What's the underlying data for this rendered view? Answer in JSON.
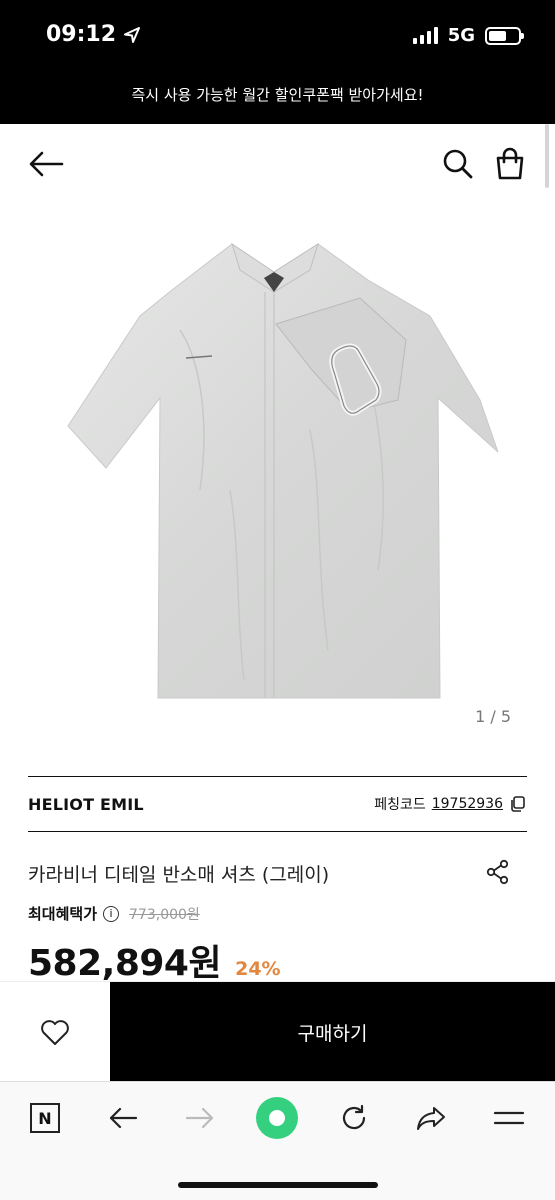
{
  "status_bar": {
    "time": "09:12",
    "network": "5G"
  },
  "promo_banner": "즉시 사용 가능한 월간 할인쿠폰팩 받아가세요!",
  "header": {
    "back_icon": "arrow-left-icon",
    "search_icon": "search-icon",
    "cart_icon": "shopping-bag-icon"
  },
  "gallery": {
    "counter": "1 / 5",
    "current": 1,
    "total": 5
  },
  "product": {
    "brand": "HELIOT EMIL",
    "code_label": "페칭코드",
    "code_value": "19752936",
    "title": "카라비너 디테일 반소매 셔츠 (그레이)",
    "benefit_label": "최대혜택가",
    "original_price": "773,000원",
    "price": "582,894원",
    "discount": "24%"
  },
  "actions": {
    "like_icon": "heart-icon",
    "buy_label": "구매하기"
  },
  "browser_nav": {
    "items": [
      "naver-icon",
      "back-arrow-icon",
      "forward-arrow-icon",
      "green-dot-button",
      "reload-icon",
      "share-icon",
      "menu-icon"
    ]
  },
  "colors": {
    "discount": "#e3873e",
    "buy_button": "#000000",
    "nav_green": "#35d07f"
  }
}
